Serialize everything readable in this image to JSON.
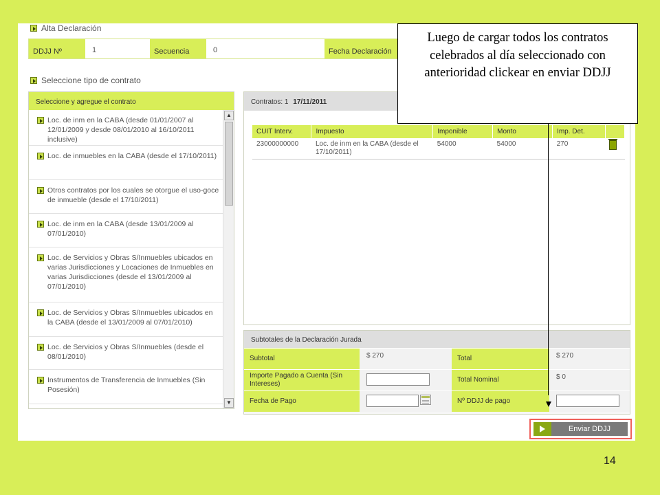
{
  "page_number": "14",
  "alta": {
    "title": "Alta Declaración",
    "ddjj_label": "DDJJ Nº",
    "ddjj_value": "1",
    "secuencia_label": "Secuencia",
    "secuencia_value": "0",
    "fecha_label": "Fecha Declaración"
  },
  "contract_section": {
    "title": "Seleccione tipo de contrato",
    "list_header": "Seleccione y agregue el contrato",
    "items": [
      "Loc. de inm en la CABA (desde 01/01/2007 al 12/01/2009 y desde 08/01/2010 al 16/10/2011 inclusive)",
      "Loc. de inmuebles en la CABA (desde el 17/10/2011)",
      "Otros contratos por los cuales se otorgue el uso-goce de inmueble (desde el 17/10/2011)",
      "Loc. de inm en la CABA (desde 13/01/2009 al 07/01/2010)",
      "Loc. de Servicios y Obras S/Inmuebles ubicados en varias Jurisdicciones y Locaciones de Inmuebles en varias Jurisdicciones (desde el 13/01/2009 al 07/01/2010)",
      "Loc. de Servicios y Obras S/Inmuebles ubicados en la CABA (desde el 13/01/2009 al 07/01/2010)",
      "Loc. de Servicios y Obras S/Inmuebles (desde el 08/01/2010)",
      "Instrumentos de Transferencia de Inmuebles (Sin Posesión)"
    ]
  },
  "contracts": {
    "label": "Contratos:",
    "count": "1",
    "date": "17/11/2011",
    "columns": [
      "CUIT Interv.",
      "Impuesto",
      "Imponible",
      "Monto",
      "Imp. Det."
    ],
    "rows": [
      {
        "cuit": "23000000000",
        "impuesto": "Loc. de inm en la CABA (desde el 17/10/2011)",
        "imponible": "54000",
        "monto": "54000",
        "imp_det": "270"
      }
    ]
  },
  "subtotals": {
    "title": "Subtotales de la Declaración Jurada",
    "subtotal_label": "Subtotal",
    "subtotal_value": "$  270",
    "total_label": "Total",
    "total_value": "$  270",
    "importe_label": "Importe Pagado a Cuenta (Sin Intereses)",
    "total_nominal_label": "Total Nominal",
    "total_nominal_value": "$  0",
    "fecha_pago_label": "Fecha de Pago",
    "ddjj_pago_label": "Nº DDJJ de pago"
  },
  "send_button_label": "Enviar DDJJ",
  "callout": "Luego de cargar todos los contratos celebrados al día seleccionado con anterioridad clickear en enviar DDJJ"
}
